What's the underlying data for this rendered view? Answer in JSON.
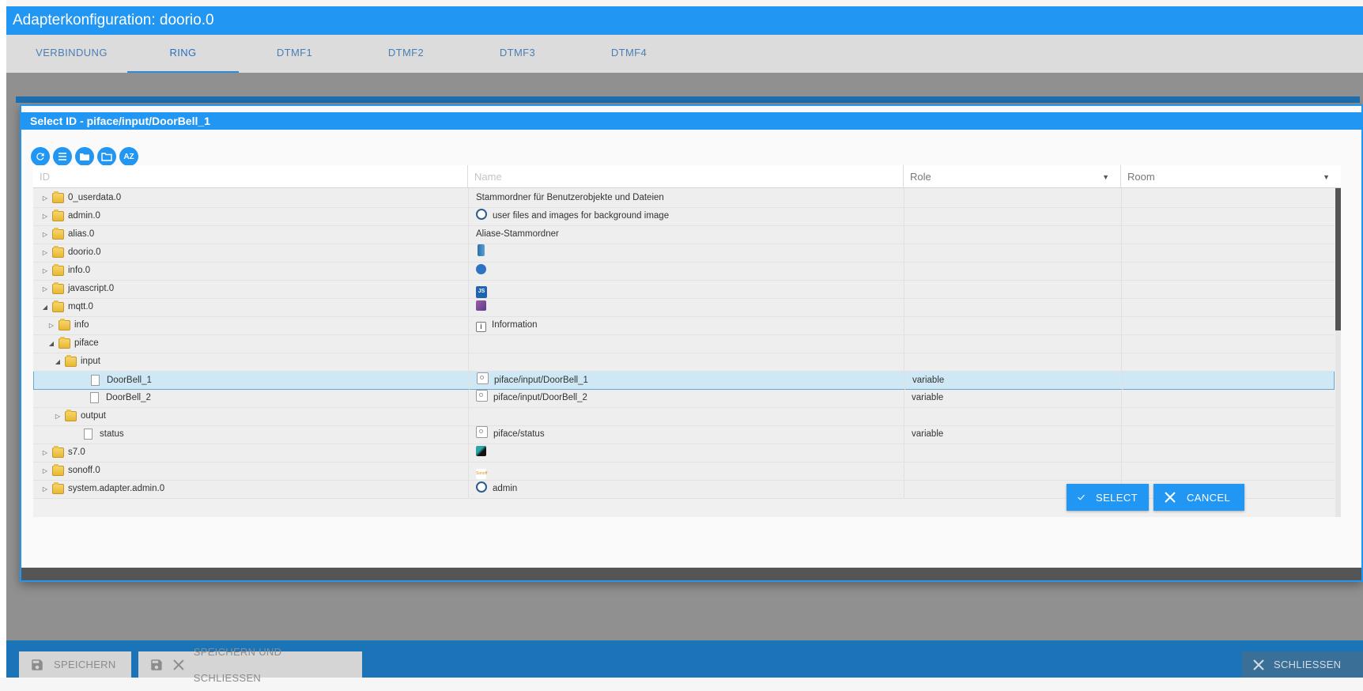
{
  "window": {
    "title": "Adapterkonfiguration: doorio.0"
  },
  "tabs": [
    {
      "label": "VERBINDUNG"
    },
    {
      "label": "RING"
    },
    {
      "label": "DTMF1"
    },
    {
      "label": "DTMF2"
    },
    {
      "label": "DTMF3"
    },
    {
      "label": "DTMF4"
    }
  ],
  "active_tab": "RING",
  "dialog": {
    "title": "Select ID - piface/input/DoorBell_1",
    "toolbar": {
      "icons": [
        "refresh-icon",
        "list-icon",
        "folder-icon",
        "folder-open-icon",
        "sort-az-icon"
      ],
      "sort_label": "AZ"
    },
    "columns": {
      "id": "ID",
      "name": "Name",
      "role": "Role",
      "room": "Room"
    },
    "rows": [
      {
        "id": "0_userdata.0",
        "name": "Stammordner für Benutzerobjekte und Dateien",
        "role": "",
        "type": "folder",
        "toggle": "▷",
        "indent": 0,
        "icon": ""
      },
      {
        "id": "admin.0",
        "name": "user files and images for background image",
        "role": "",
        "type": "folder",
        "toggle": "▷",
        "indent": 0,
        "icon": "admin-icon"
      },
      {
        "id": "alias.0",
        "name": "Aliase-Stammordner",
        "role": "",
        "type": "folder",
        "toggle": "▷",
        "indent": 0,
        "icon": ""
      },
      {
        "id": "doorio.0",
        "name": "",
        "role": "",
        "type": "folder",
        "toggle": "▷",
        "indent": 0,
        "icon": "doorio-icon"
      },
      {
        "id": "info.0",
        "name": "",
        "role": "",
        "type": "folder",
        "toggle": "▷",
        "indent": 0,
        "icon": "info-adapter-icon"
      },
      {
        "id": "javascript.0",
        "name": "",
        "role": "",
        "type": "folder",
        "toggle": "▷",
        "indent": 0,
        "icon": "javascript-icon"
      },
      {
        "id": "mqtt.0",
        "name": "",
        "role": "",
        "type": "folder",
        "toggle": "◢",
        "indent": 0,
        "icon": "mqtt-icon"
      },
      {
        "id": "info",
        "name": "Information",
        "role": "",
        "type": "folder",
        "toggle": "▷",
        "indent": 1,
        "icon": "info-box-icon"
      },
      {
        "id": "piface",
        "name": "",
        "role": "",
        "type": "folder",
        "toggle": "◢",
        "indent": 1,
        "icon": ""
      },
      {
        "id": "input",
        "name": "",
        "role": "",
        "type": "folder",
        "toggle": "◢",
        "indent": 2,
        "icon": ""
      },
      {
        "id": "DoorBell_1",
        "name": "piface/input/DoorBell_1",
        "role": "variable",
        "type": "file",
        "toggle": "",
        "indent": 3,
        "icon": "state-icon",
        "selected": true
      },
      {
        "id": "DoorBell_2",
        "name": "piface/input/DoorBell_2",
        "role": "variable",
        "type": "file",
        "toggle": "",
        "indent": 3,
        "icon": "state-icon"
      },
      {
        "id": "output",
        "name": "",
        "role": "",
        "type": "folder",
        "toggle": "▷",
        "indent": 2,
        "icon": ""
      },
      {
        "id": "status",
        "name": "piface/status",
        "role": "variable",
        "type": "file",
        "toggle": "",
        "indent": 2,
        "icon": "state-icon"
      },
      {
        "id": "s7.0",
        "name": "",
        "role": "",
        "type": "folder",
        "toggle": "▷",
        "indent": 0,
        "icon": "s7-icon"
      },
      {
        "id": "sonoff.0",
        "name": "",
        "role": "",
        "type": "folder",
        "toggle": "▷",
        "indent": 0,
        "icon": "sonoff-icon"
      },
      {
        "id": "system.adapter.admin.0",
        "name": "admin",
        "role": "",
        "type": "folder",
        "toggle": "▷",
        "indent": 0,
        "icon": "admin-icon"
      }
    ],
    "buttons": {
      "select": "SELECT",
      "cancel": "CANCEL"
    }
  },
  "footer": {
    "save": "SPEICHERN",
    "save_close": "SPEICHERN UND SCHLIESSEN",
    "close": "SCHLIESSEN"
  },
  "colors": {
    "primary": "#2196f3",
    "selected_row": "#cfe8f5",
    "footer": "#1b74b8"
  }
}
